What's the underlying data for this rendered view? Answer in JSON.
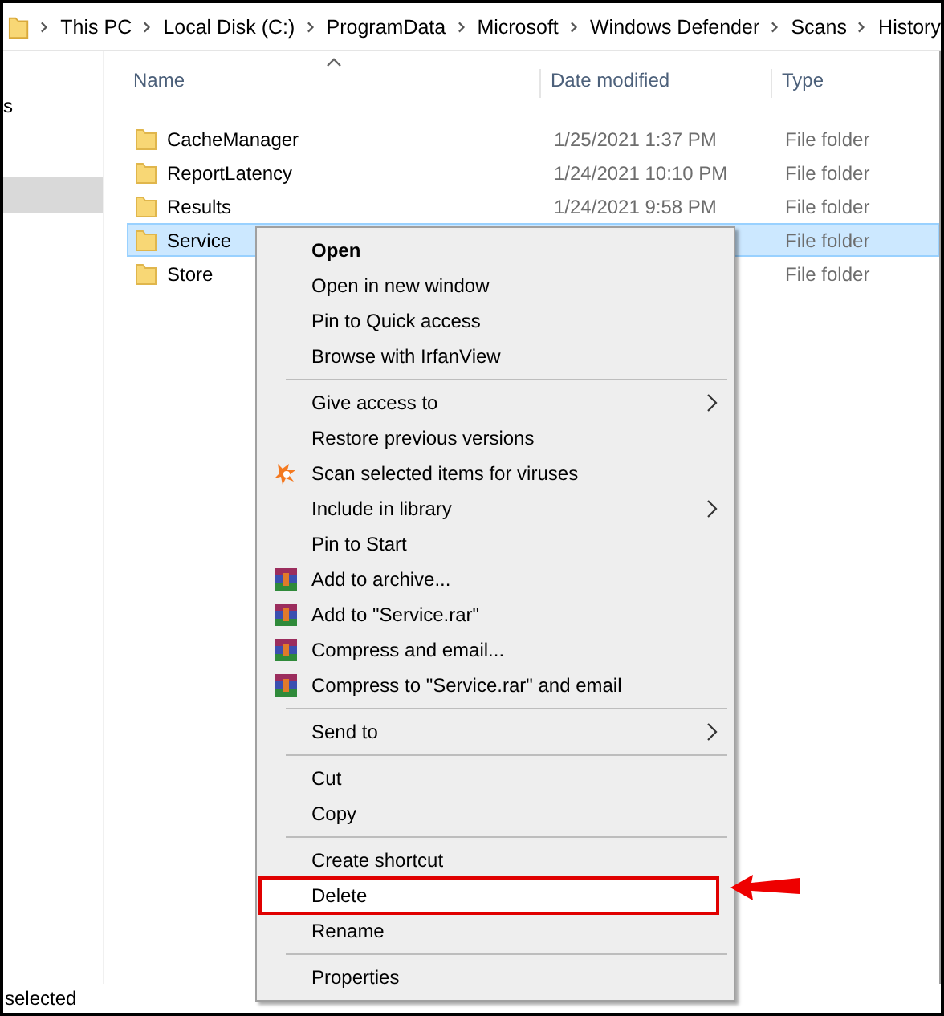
{
  "breadcrumb": [
    "This PC",
    "Local Disk (C:)",
    "ProgramData",
    "Microsoft",
    "Windows Defender",
    "Scans",
    "History"
  ],
  "nav": {
    "partial_label": "s"
  },
  "columns": [
    "Name",
    "Date modified",
    "Type"
  ],
  "rows": [
    {
      "name": "CacheManager",
      "date": "1/25/2021 1:37 PM",
      "type": "File folder",
      "selected": false
    },
    {
      "name": "ReportLatency",
      "date": "1/24/2021 10:10 PM",
      "type": "File folder",
      "selected": false
    },
    {
      "name": "Results",
      "date": "1/24/2021 9:58 PM",
      "type": "File folder",
      "selected": false
    },
    {
      "name": "Service",
      "type": "File folder",
      "selected": true
    },
    {
      "name": "Store",
      "type": "File folder",
      "selected": false
    }
  ],
  "context_menu": [
    {
      "kind": "item",
      "label": "Open",
      "bold": true,
      "submenu": false,
      "highlighted": false
    },
    {
      "kind": "item",
      "label": "Open in new window",
      "bold": false,
      "submenu": false,
      "highlighted": false
    },
    {
      "kind": "item",
      "label": "Pin to Quick access",
      "bold": false,
      "submenu": false,
      "highlighted": false
    },
    {
      "kind": "item",
      "label": "Browse with IrfanView",
      "bold": false,
      "submenu": false,
      "highlighted": false
    },
    {
      "kind": "separator"
    },
    {
      "kind": "item",
      "label": "Give access to",
      "bold": false,
      "submenu": true,
      "highlighted": false
    },
    {
      "kind": "item",
      "label": "Restore previous versions",
      "bold": false,
      "submenu": false,
      "highlighted": false
    },
    {
      "kind": "scan",
      "label": "Scan selected items for viruses",
      "bold": false,
      "submenu": false,
      "highlighted": false
    },
    {
      "kind": "item",
      "label": "Include in library",
      "bold": false,
      "submenu": true,
      "highlighted": false
    },
    {
      "kind": "item",
      "label": "Pin to Start",
      "bold": false,
      "submenu": false,
      "highlighted": false
    },
    {
      "kind": "archive",
      "label": "Add to archive...",
      "bold": false,
      "submenu": false,
      "highlighted": false
    },
    {
      "kind": "archive",
      "label": "Add to \"Service.rar\"",
      "bold": false,
      "submenu": false,
      "highlighted": false
    },
    {
      "kind": "archive",
      "label": "Compress and email...",
      "bold": false,
      "submenu": false,
      "highlighted": false
    },
    {
      "kind": "archive",
      "label": "Compress to \"Service.rar\" and email",
      "bold": false,
      "submenu": false,
      "highlighted": false
    },
    {
      "kind": "separator"
    },
    {
      "kind": "item",
      "label": "Send to",
      "bold": false,
      "submenu": true,
      "highlighted": false
    },
    {
      "kind": "separator"
    },
    {
      "kind": "item",
      "label": "Cut",
      "bold": false,
      "submenu": false,
      "highlighted": false
    },
    {
      "kind": "item",
      "label": "Copy",
      "bold": false,
      "submenu": false,
      "highlighted": false
    },
    {
      "kind": "separator"
    },
    {
      "kind": "item",
      "label": "Create shortcut",
      "bold": false,
      "submenu": false,
      "highlighted": false
    },
    {
      "kind": "item",
      "label": "Delete",
      "bold": false,
      "submenu": false,
      "highlighted": true
    },
    {
      "kind": "item",
      "label": "Rename",
      "bold": false,
      "submenu": false,
      "highlighted": false
    },
    {
      "kind": "separator"
    },
    {
      "kind": "item",
      "label": "Properties",
      "bold": false,
      "submenu": false,
      "highlighted": false
    }
  ],
  "status_bar": "selected"
}
